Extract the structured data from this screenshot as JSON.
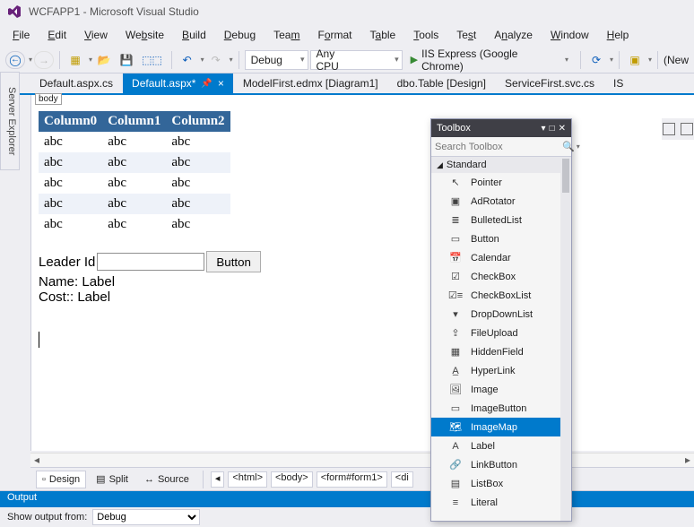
{
  "window": {
    "title": "WCFAPP1 - Microsoft Visual Studio"
  },
  "menu": {
    "file": "File",
    "edit": "Edit",
    "view": "View",
    "website": "Website",
    "build": "Build",
    "debug": "Debug",
    "team": "Team",
    "format": "Format",
    "table": "Table",
    "tools": "Tools",
    "test": "Test",
    "analyze": "Analyze",
    "window": "Window",
    "help": "Help"
  },
  "toolbar": {
    "config": "Debug",
    "platform": "Any CPU",
    "run": "IIS Express (Google Chrome)",
    "new_truncated": "(New "
  },
  "tabs": {
    "t0": "Default.aspx.cs",
    "t1": "Default.aspx*",
    "t2": "ModelFirst.edmx [Diagram1]",
    "t3": "dbo.Table [Design]",
    "t4": "ServiceFirst.svc.cs",
    "t5": "IS"
  },
  "sidetab": {
    "label": "Server Explorer"
  },
  "designer": {
    "breadcrumb": "body",
    "grid": {
      "headers": [
        "Column0",
        "Column1",
        "Column2"
      ],
      "rows": [
        [
          "abc",
          "abc",
          "abc"
        ],
        [
          "abc",
          "abc",
          "abc"
        ],
        [
          "abc",
          "abc",
          "abc"
        ],
        [
          "abc",
          "abc",
          "abc"
        ],
        [
          "abc",
          "abc",
          "abc"
        ]
      ]
    },
    "form": {
      "leader_label": "Leader Id",
      "button_label": "Button",
      "name_label": "Name: Label",
      "cost_label": "Cost:: Label"
    }
  },
  "designbar": {
    "design": "Design",
    "split": "Split",
    "source": "Source",
    "bc": [
      "<html>",
      "<body>",
      "<form#form1>",
      "<di"
    ]
  },
  "output": {
    "title": "Output",
    "show_from": "Show output from:",
    "selected": "Debug"
  },
  "toolbox": {
    "title": "Toolbox",
    "search_placeholder": "Search Toolbox",
    "category": "Standard",
    "items": [
      "Pointer",
      "AdRotator",
      "BulletedList",
      "Button",
      "Calendar",
      "CheckBox",
      "CheckBoxList",
      "DropDownList",
      "FileUpload",
      "HiddenField",
      "HyperLink",
      "Image",
      "ImageButton",
      "ImageMap",
      "Label",
      "LinkButton",
      "ListBox",
      "Literal"
    ],
    "selected_index": 13
  }
}
